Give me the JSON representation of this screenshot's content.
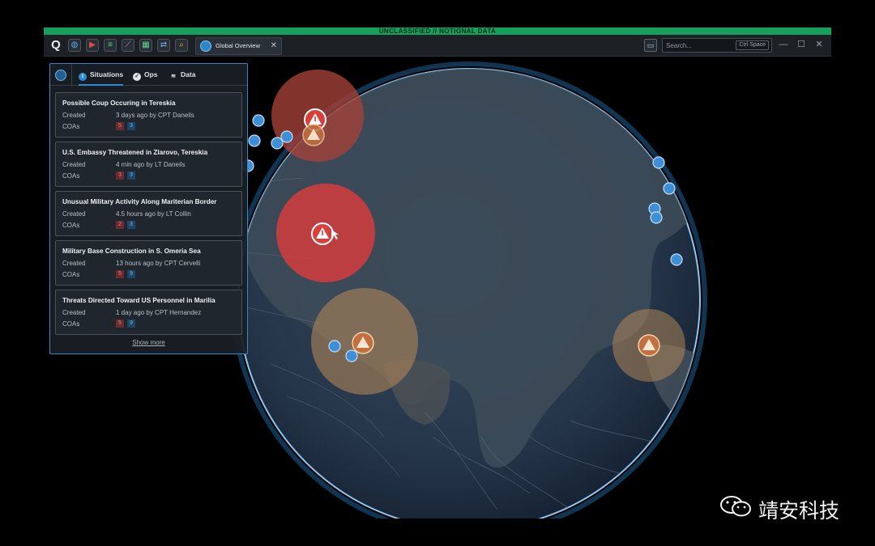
{
  "banner": {
    "text": "UNCLASSIFIED // NOTIONAL DATA"
  },
  "toolbar": {
    "logo": "Q",
    "apps": [
      "globe-app-icon",
      "video-app-icon",
      "timeline-app-icon",
      "graph-app-icon",
      "table-app-icon",
      "link-app-icon",
      "search-app-icon"
    ],
    "tab": {
      "label": "Global Overview",
      "close": "✕"
    },
    "search_placeholder": "Search...",
    "search_shortcut": "Ctrl Space",
    "window": {
      "minimize": "—",
      "maximize": "☐",
      "close": "✕"
    }
  },
  "panel": {
    "tabs": [
      {
        "label": "Situations",
        "icon": "info-icon",
        "active": true
      },
      {
        "label": "Ops",
        "icon": "check-circle-icon",
        "active": false
      },
      {
        "label": "Data",
        "icon": "stack-icon",
        "active": false
      }
    ],
    "situations": [
      {
        "title": "Possible Coup Occuring in Tereskia",
        "created_label": "Created",
        "created": "3 days ago by CPT Daneils",
        "coas_label": "COAs",
        "coa_red": "5",
        "coa_blue": "3"
      },
      {
        "title": "U.S. Embassy Threatened in Zlarovo, Tereskia",
        "created_label": "Created",
        "created": "4 min ago by LT Daneils",
        "coas_label": "COAs",
        "coa_red": "3",
        "coa_blue": "3"
      },
      {
        "title": "Unusual Military Activity Along Mariterian Border",
        "created_label": "Created",
        "created": "4.5 hours ago by LT Collin",
        "coas_label": "COAs",
        "coa_red": "2",
        "coa_blue": "3"
      },
      {
        "title": "Military Base Construction in S. Omeria Sea",
        "created_label": "Created",
        "created": "13 hours ago by CPT Cervelli",
        "coas_label": "COAs",
        "coa_red": "5",
        "coa_blue": "9"
      },
      {
        "title": "Threats Directed Toward US Personnel in Marilia",
        "created_label": "Created",
        "created": "1 day ago by CPT Hernandez",
        "coas_label": "COAs",
        "coa_red": "5",
        "coa_blue": "9"
      }
    ],
    "show_more": "Show more"
  },
  "map": {
    "alert_icon": "warning-triangle-icon",
    "unit_icon": "aircraft-unit-icon",
    "colors": {
      "globe": "#2a3b4c",
      "land": "#3a4856",
      "alert_red": "#e04040",
      "alert_amber": "#b98b57",
      "unit_blue": "#3f8fd6"
    }
  },
  "watermark": {
    "text": "靖安科技"
  }
}
